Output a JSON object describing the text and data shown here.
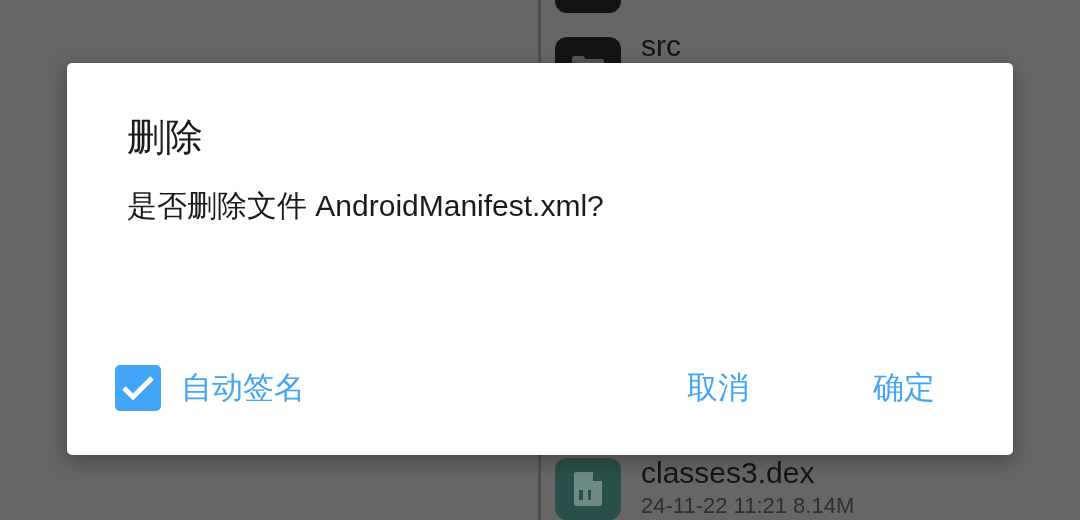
{
  "file_list": [
    {
      "kind": "file"
    },
    {
      "kind": "folder",
      "name": "src"
    },
    {
      "kind": "dex",
      "name": "classes3.dex",
      "meta": "24-11-22 11:21  8.14M"
    }
  ],
  "dialog": {
    "title": "删除",
    "message": "是否删除文件 AndroidManifest.xml?",
    "checkbox": {
      "label": "自动签名",
      "checked": true
    },
    "buttons": [
      "取消",
      "确定"
    ]
  }
}
